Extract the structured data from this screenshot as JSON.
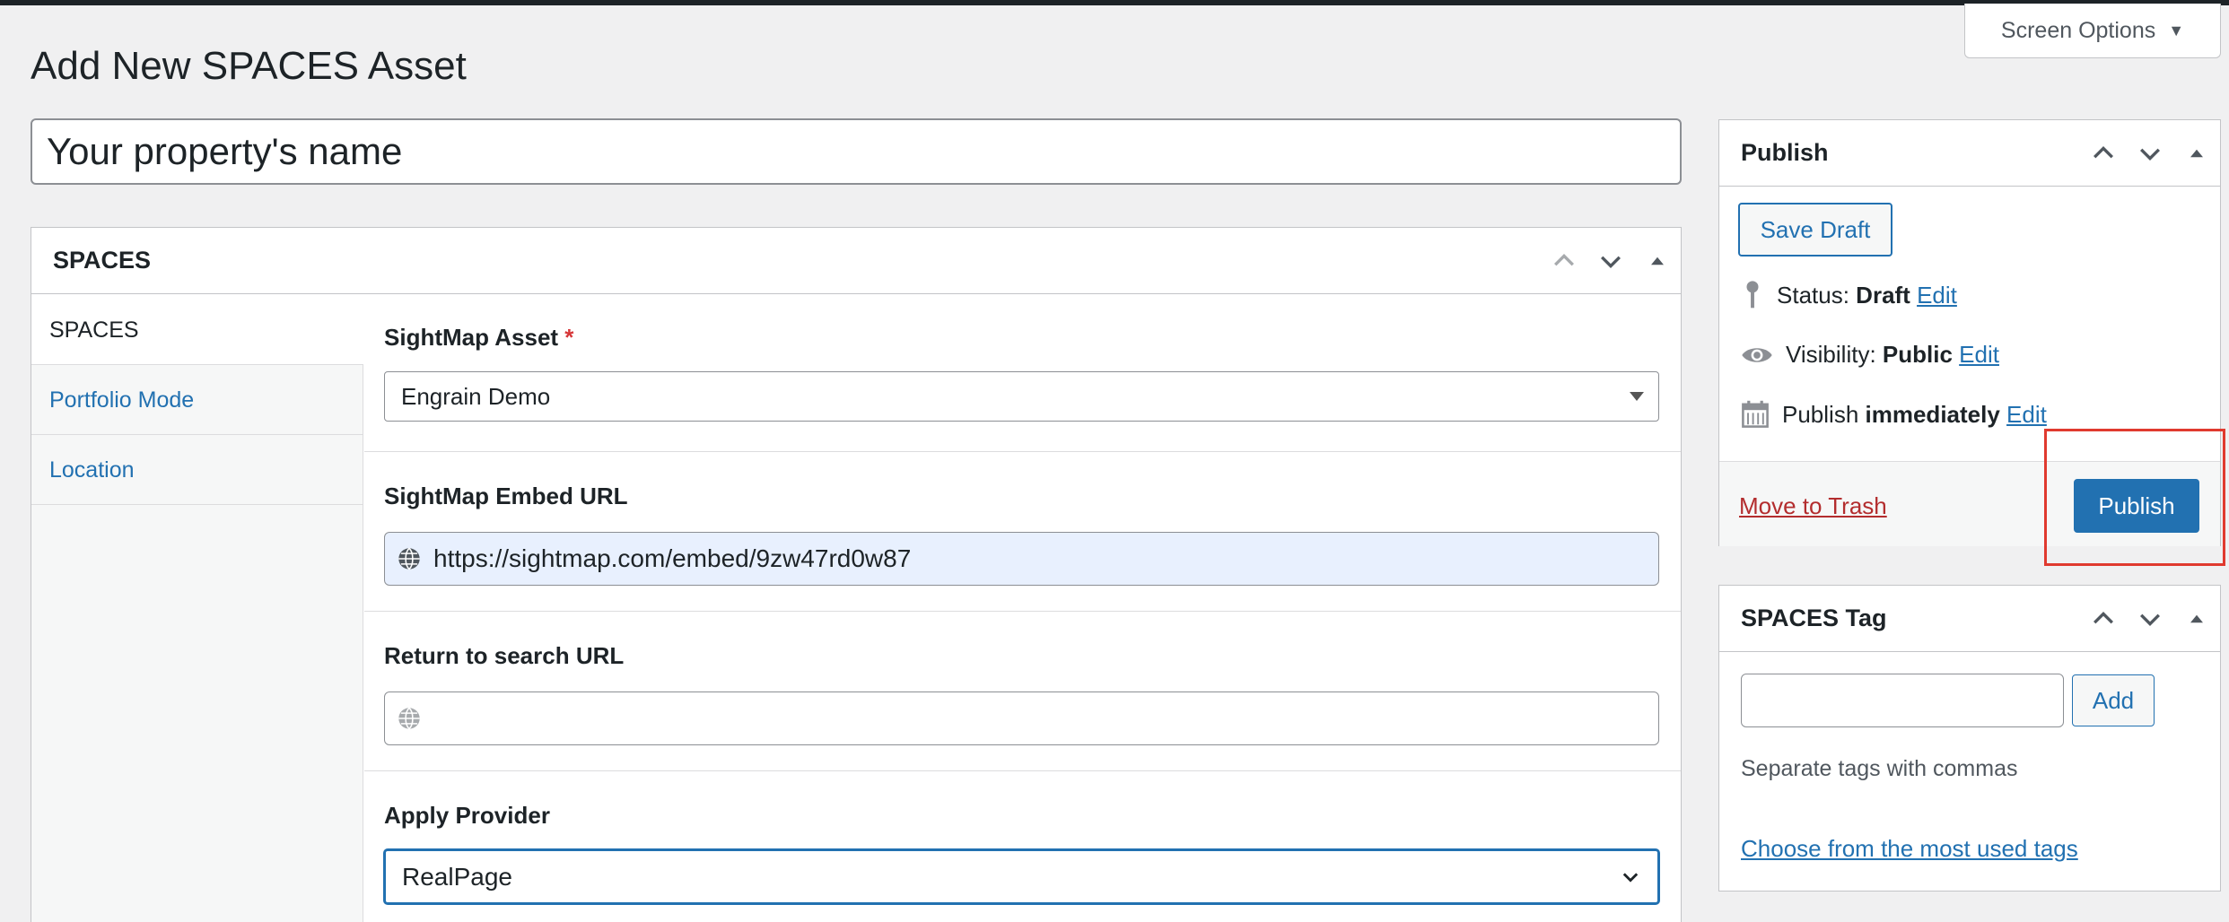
{
  "screen_options": {
    "label": "Screen Options"
  },
  "page": {
    "title": "Add New SPACES Asset"
  },
  "title_field": {
    "value": "Your property's name"
  },
  "main_box": {
    "title": "SPACES",
    "tabs": [
      {
        "label": "SPACES"
      },
      {
        "label": "Portfolio Mode"
      },
      {
        "label": "Location"
      }
    ],
    "fields": {
      "asset": {
        "label": "SightMap Asset",
        "required": "*",
        "value": "Engrain Demo"
      },
      "embed_url": {
        "label": "SightMap Embed URL",
        "value": "https://sightmap.com/embed/9zw47rd0w87"
      },
      "return_url": {
        "label": "Return to search URL",
        "value": ""
      },
      "provider": {
        "label": "Apply Provider",
        "value": "RealPage"
      }
    }
  },
  "publish_box": {
    "title": "Publish",
    "save_draft": "Save Draft",
    "status": {
      "label": "Status:",
      "value": "Draft",
      "edit": "Edit"
    },
    "visibility": {
      "label": "Visibility:",
      "value": "Public",
      "edit": "Edit"
    },
    "schedule": {
      "label": "Publish",
      "value": "immediately",
      "edit": "Edit"
    },
    "trash": "Move to Trash",
    "publish": "Publish"
  },
  "tags_box": {
    "title": "SPACES Tag",
    "add": "Add",
    "help": "Separate tags with commas",
    "choose": "Choose from the most used tags"
  },
  "colors": {
    "accent": "#2271b1",
    "highlight": "#e03a2f",
    "danger": "#b32d2e"
  }
}
